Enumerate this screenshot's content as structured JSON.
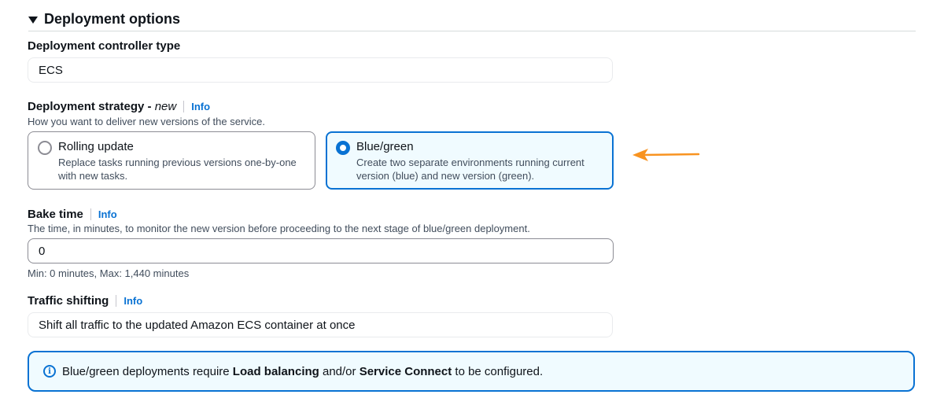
{
  "section": {
    "title": "Deployment options"
  },
  "controller": {
    "label": "Deployment controller type",
    "value": "ECS"
  },
  "strategy": {
    "label": "Deployment strategy - ",
    "label_suffix": "new",
    "info": "Info",
    "description": "How you want to deliver new versions of the service.",
    "options": [
      {
        "title": "Rolling update",
        "description": "Replace tasks running previous versions one-by-one with new tasks.",
        "selected": false
      },
      {
        "title": "Blue/green",
        "description": "Create two separate environments running current version (blue) and new version (green).",
        "selected": true
      }
    ]
  },
  "bake_time": {
    "label": "Bake time",
    "info": "Info",
    "description": "The time, in minutes, to monitor the new version before proceeding to the next stage of blue/green deployment.",
    "value": "0",
    "constraint": "Min: 0 minutes, Max: 1,440 minutes"
  },
  "traffic_shifting": {
    "label": "Traffic shifting",
    "info": "Info",
    "value": "Shift all traffic to the updated Amazon ECS container at once"
  },
  "alert": {
    "text_1": "Blue/green deployments require ",
    "bold_1": "Load balancing",
    "text_2": " and/or ",
    "bold_2": "Service Connect",
    "text_3": " to be configured."
  },
  "colors": {
    "accent": "#0972d3",
    "annotation_arrow": "#f89320"
  }
}
